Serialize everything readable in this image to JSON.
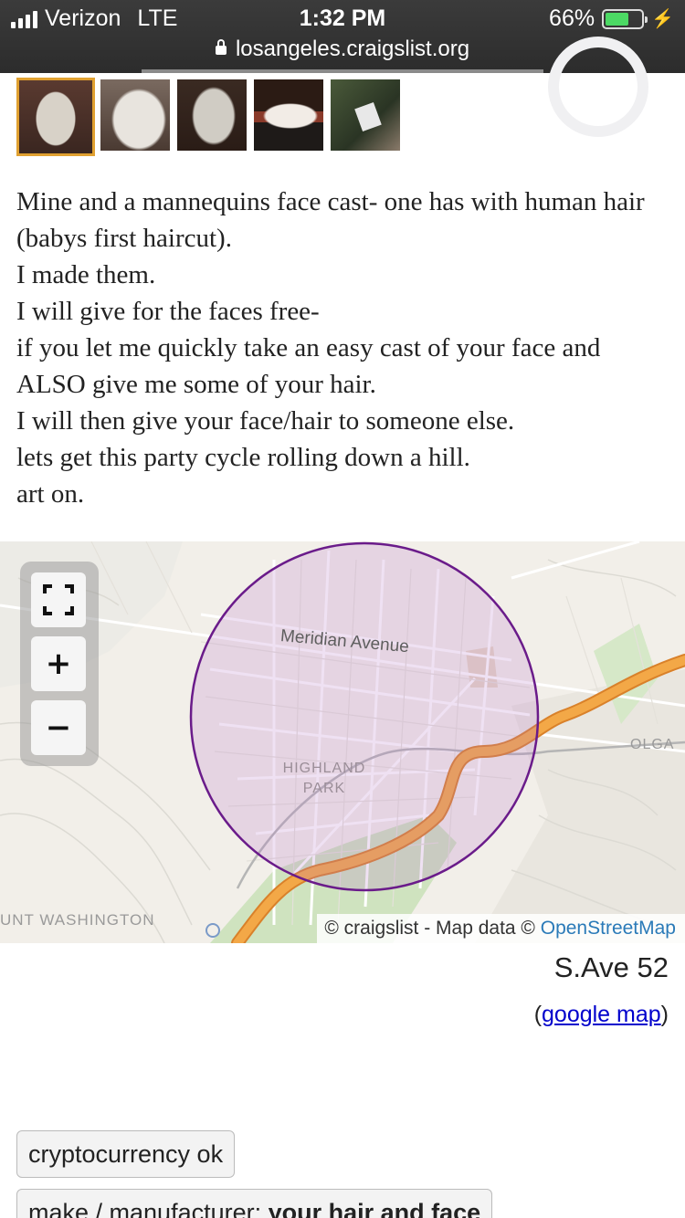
{
  "status_bar": {
    "carrier": "Verizon",
    "network": "LTE",
    "time": "1:32 PM",
    "battery_percent": "66%",
    "battery_level": 0.66
  },
  "url_bar": {
    "domain": "losangeles.craigslist.org"
  },
  "post": {
    "body_lines": [
      "Mine and a mannequins face cast- one has with human hair (babys first haircut).",
      "I made them.",
      "I will give for the faces free-",
      "if you let me quickly take an easy cast of your face and ALSO give me some of your hair.",
      "I will then give your face/hair to someone else.",
      "lets get this party cycle rolling down a hill.",
      "art on."
    ]
  },
  "map": {
    "labels": {
      "street": "Meridian Avenue",
      "neighborhood_line1": "HIGHLAND",
      "neighborhood_line2": "PARK",
      "east": "OLGA",
      "southwest": "UNT WASHINGTON"
    },
    "attribution_prefix": "© craigslist - Map data © ",
    "attribution_link": "OpenStreetMap",
    "controls": {
      "fullscreen": "fullscreen-icon",
      "zoom_in": "+",
      "zoom_out": "−"
    }
  },
  "location": {
    "address": "S.Ave 52",
    "google_map_open": "(",
    "google_map_link": "google map",
    "google_map_close": ")"
  },
  "attributes": [
    {
      "text": "cryptocurrency ok"
    },
    {
      "label": "make / manufacturer: ",
      "value": "your hair and face"
    }
  ],
  "colors": {
    "accent_selected_thumb": "#e0a030",
    "radius_circle": "#6a1b8a",
    "freeway": "#f0a03c",
    "link": "#0000cc"
  }
}
